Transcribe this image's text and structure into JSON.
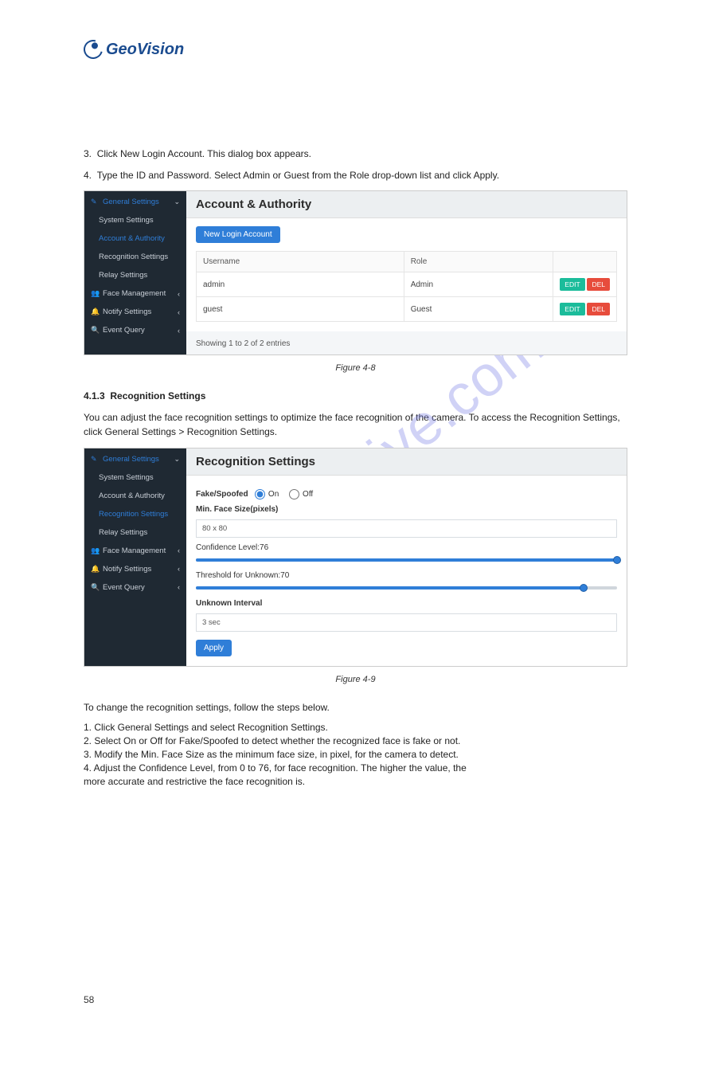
{
  "logo_text": "GeoVision",
  "intro": {
    "line1_prefix": "3.",
    "line1_text": "Click New Login Account. This dialog box appears.",
    "line2_prefix": "4.",
    "line2_text": "Type the ID and Password. Select Admin or Guest from the Role drop-down list and click Apply."
  },
  "shot1": {
    "sidebar": {
      "general": "General Settings",
      "items": [
        "System Settings",
        "Account & Authority",
        "Recognition Settings",
        "Relay Settings"
      ],
      "face_mgmt": "Face Management",
      "notify": "Notify Settings",
      "event": "Event Query"
    },
    "title": "Account & Authority",
    "new_btn": "New Login Account",
    "cols": {
      "user": "Username",
      "role": "Role"
    },
    "rows": [
      {
        "user": "admin",
        "role": "Admin"
      },
      {
        "user": "guest",
        "role": "Guest"
      }
    ],
    "edit": "EDIT",
    "del": "DEL",
    "entries": "Showing 1 to 2 of 2 entries"
  },
  "caption1": "Figure 4-8",
  "section": {
    "num": "4.1.3",
    "title": "Recognition Settings",
    "desc": "You can adjust the face recognition settings to optimize the face recognition of the camera. To access the Recognition Settings, click General Settings > Recognition Settings.",
    "steps_intro": "To change the recognition settings, follow the steps below.",
    "steps": [
      "1.  Click General Settings and select Recognition Settings.",
      "2.  Select On or Off for Fake/Spoofed to detect whether the recognized face is fake or not.",
      "3.  Modify the Min. Face Size as the minimum face size, in pixel, for the camera to detect.",
      "4.  Adjust the Confidence Level, from 0 to 76, for face recognition. The higher the value, the",
      "     more accurate and restrictive the face recognition is."
    ]
  },
  "shot2": {
    "sidebar": {
      "general": "General Settings",
      "items": [
        "System Settings",
        "Account & Authority",
        "Recognition Settings",
        "Relay Settings"
      ],
      "face_mgmt": "Face Management",
      "notify": "Notify Settings",
      "event": "Event Query"
    },
    "title": "Recognition Settings",
    "fake_label": "Fake/Spoofed",
    "on": "On",
    "off": "Off",
    "min_face": "Min. Face Size(pixels)",
    "min_face_val": "80 x 80",
    "conf": "Confidence Level:76",
    "conf_pct": 100,
    "thresh": "Threshold for Unknown:70",
    "thresh_pct": 92,
    "unknown_int": "Unknown Interval",
    "unknown_val": "3 sec",
    "apply": "Apply"
  },
  "caption2": "Figure 4-9",
  "page_num": "58",
  "watermark": "manualshive.com"
}
